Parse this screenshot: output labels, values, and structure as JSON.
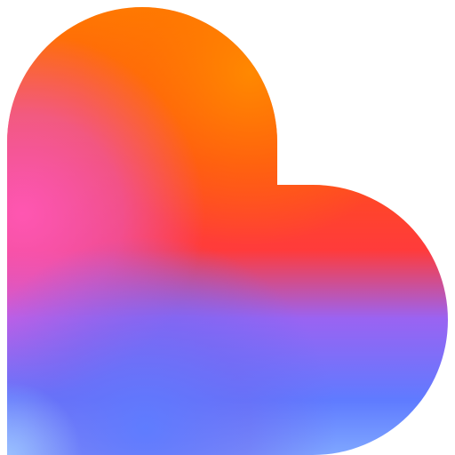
{
  "logo": {
    "icon": "heart-logo-icon",
    "shape": "rotated heart",
    "colors": {
      "orange": "#FF7A00",
      "orange_red": "#FF4E1A",
      "red": "#FF3B3B",
      "pink": "#E85AD8",
      "purple": "#9A63F2",
      "blue": "#5F7BFF",
      "light_blue": "#7FA7FF",
      "background": "#FFFFFF"
    }
  }
}
